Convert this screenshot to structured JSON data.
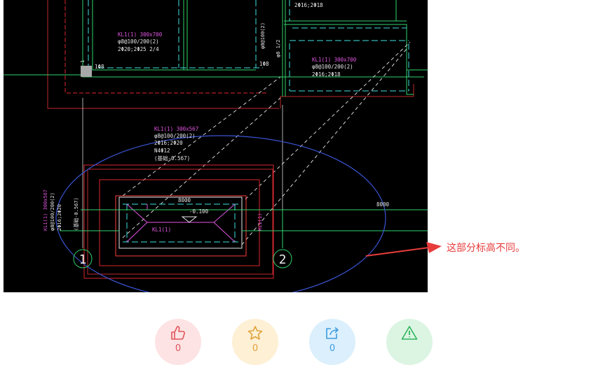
{
  "drawing": {
    "labels": {
      "beam_top1": "KL1(1) 300x700",
      "beam_top2": "φ8@100/200(2)",
      "beam_top3": "2Φ20;2Φ25 2/4",
      "beam_top4": "1Φ8",
      "beam_right1": "KL1(1) 300x700",
      "beam_right2": "φ8@100/200(2)",
      "beam_right3": "2Φ16;2Φ18",
      "beam_rt1": "2Φ16;2Φ18",
      "beam_vert1": "φ8@100(2)",
      "beam_vert2": "φ8 1/2",
      "beam_mid1": "KL1(1) 300x567",
      "beam_mid2": "φ8@100/200(2)",
      "beam_mid3": "2Φ16;2Φ20",
      "beam_mid4": "N4Φ12",
      "beam_mid5": "(基础-0.567)",
      "beam_left1": "KL1(1) 300x567",
      "beam_left2": "φ8@100/200(2)",
      "beam_left3": "2Φ16;2Φ20",
      "beam_left4": "(基础-0.567)",
      "box_left": "KL1(1)",
      "box_right": "KL1(1)",
      "dim_inner": "8000",
      "dim_outer": "8000",
      "level": "-0.100",
      "small_a": "1",
      "small_b": "1Φ8"
    },
    "axis_left": "1",
    "axis_right": "2"
  },
  "annotation": {
    "text": "这部分标高不同。",
    "arrow_color": "#e83c3c"
  },
  "actions": {
    "like_count": "0",
    "favorite_count": "0",
    "share_count": "0"
  }
}
